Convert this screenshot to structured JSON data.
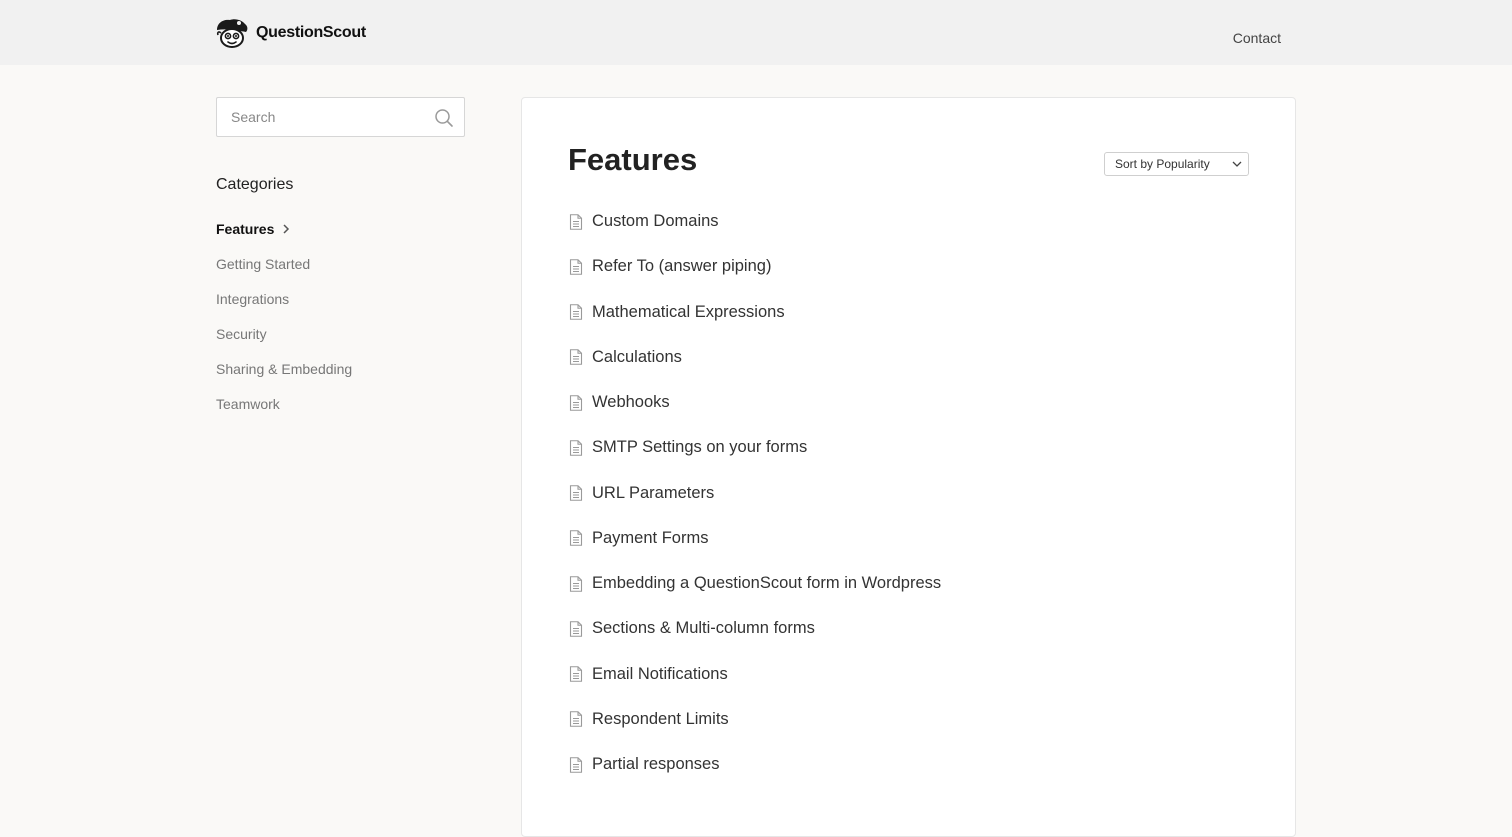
{
  "header": {
    "brand": "QuestionScout",
    "nav_contact": "Contact"
  },
  "sidebar": {
    "search_placeholder": "Search",
    "categories_heading": "Categories",
    "categories": [
      {
        "label": "Features",
        "active": true
      },
      {
        "label": "Getting Started"
      },
      {
        "label": "Integrations"
      },
      {
        "label": "Security"
      },
      {
        "label": "Sharing & Embedding"
      },
      {
        "label": "Teamwork"
      }
    ]
  },
  "main": {
    "title": "Features",
    "sort_label": "Sort by Popularity",
    "articles": [
      "Custom Domains",
      "Refer To (answer piping)",
      "Mathematical Expressions",
      "Calculations",
      "Webhooks",
      "SMTP Settings on your forms",
      "URL Parameters",
      "Payment Forms",
      "Embedding a QuestionScout form in Wordpress",
      "Sections & Multi-column forms",
      "Email Notifications",
      "Respondent Limits",
      "Partial responses"
    ]
  },
  "icons": {
    "brand_logo": "brand-logo-icon",
    "search": "search-icon",
    "active_category": "chevron-right-icon",
    "sort_dropdown": "chevron-down-icon",
    "article": "document-icon"
  },
  "colors": {
    "header_bg": "#f1f1f1",
    "page_bg": "#faf9f7",
    "panel_bg": "#ffffff",
    "text_primary": "#222222",
    "text_muted": "#777777"
  }
}
